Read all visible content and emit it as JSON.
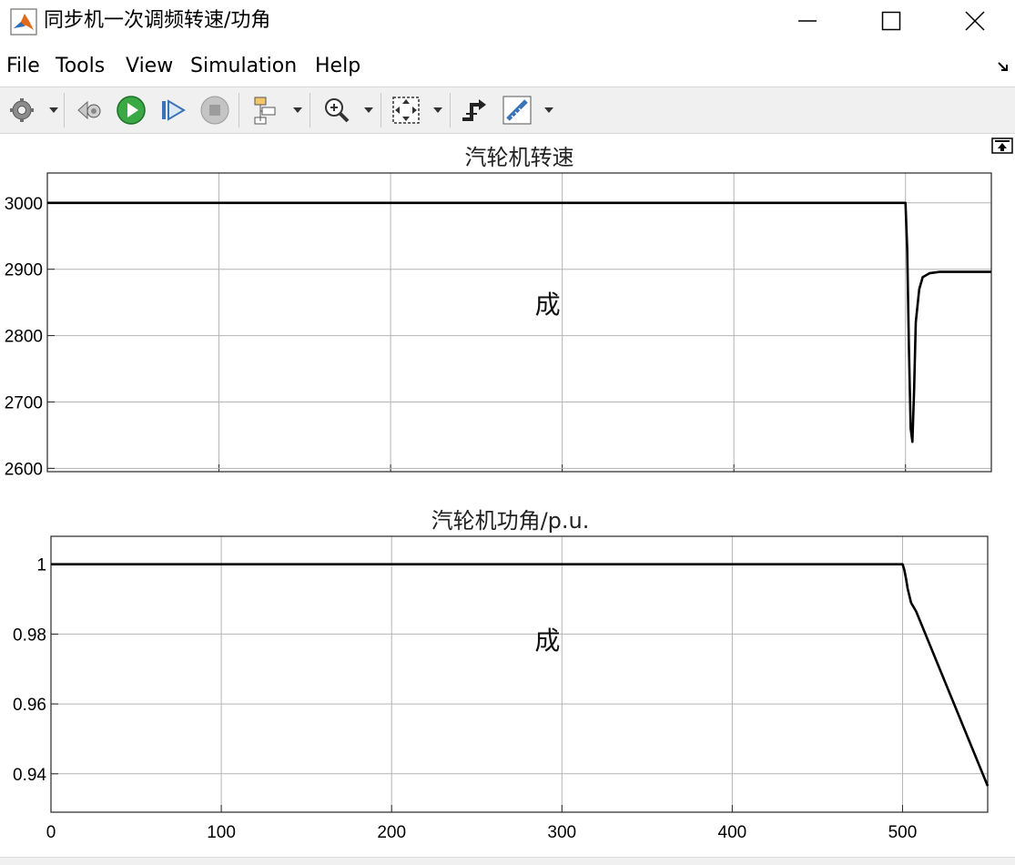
{
  "window": {
    "title": "同步机一次调频转速/功角",
    "controls": [
      "minimize-icon",
      "maximize-icon",
      "close-icon"
    ]
  },
  "menu": [
    "File",
    "Tools",
    "View",
    "Simulation",
    "Help"
  ],
  "toolbar": {
    "items": [
      "gear-icon",
      "step-back-icon",
      "run-icon",
      "step-forward-icon",
      "stop-icon",
      "highlight-block-icon",
      "zoom-icon",
      "fit-view-icon",
      "cursor-measure-icon",
      "triggers-icon"
    ]
  },
  "colors": {
    "line": "#000000",
    "grid": "#b4b4b4",
    "axes": "#262626",
    "toolbar_bg": "#f0f0f0"
  },
  "chart_data": [
    {
      "type": "line",
      "title": "汽轮机转速",
      "xlim": [
        0,
        550
      ],
      "ylim": [
        2595,
        3045
      ],
      "yticks": [
        3000,
        2900,
        2800,
        2700,
        2600
      ],
      "xticks": [
        0,
        100,
        200,
        300,
        400,
        500
      ],
      "x_tick_labels_shown": false,
      "grid": true,
      "annotation": "成",
      "series": [
        {
          "x": [
            0,
            500,
            501,
            502,
            503,
            504,
            505,
            506,
            508,
            510,
            514,
            520,
            530,
            550
          ],
          "y": [
            3000,
            3000,
            2930,
            2780,
            2660,
            2640,
            2720,
            2820,
            2870,
            2888,
            2894,
            2896,
            2896,
            2896
          ]
        }
      ]
    },
    {
      "type": "line",
      "title": "汽轮机功角/p.u.",
      "xlim": [
        0,
        550
      ],
      "ylim": [
        0.929,
        1.008
      ],
      "yticks": [
        1,
        0.98,
        0.96,
        0.94
      ],
      "xticks": [
        0,
        100,
        200,
        300,
        400,
        500
      ],
      "xticklabels": [
        "0",
        "100",
        "200",
        "300",
        "400",
        "500"
      ],
      "grid": true,
      "annotation": "成",
      "series": [
        {
          "x": [
            0,
            500,
            501,
            502,
            503,
            505,
            508,
            550
          ],
          "y": [
            1,
            1,
            0.9985,
            0.996,
            0.993,
            0.989,
            0.9865,
            0.9365
          ]
        }
      ]
    }
  ]
}
